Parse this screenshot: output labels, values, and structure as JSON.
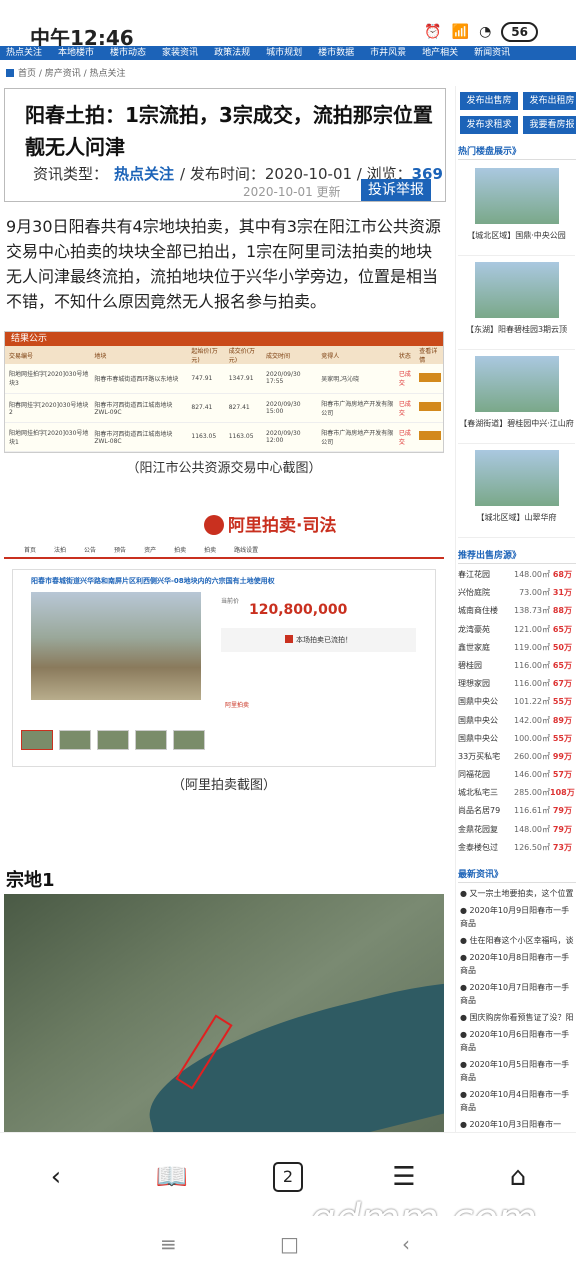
{
  "status": {
    "time": "中午12:46",
    "battery": "56",
    "hd": "HD"
  },
  "nav_strip": [
    "热点关注",
    "本地楼市",
    "楼市动态",
    "家装资讯",
    "政策法规",
    "城市规划",
    "楼市数据",
    "市井风景",
    "地产相关",
    "新闻资讯"
  ],
  "breadcrumb": "首页 / 房产资讯 / 热点关注",
  "article": {
    "title": "阳春土拍：1宗流拍，3宗成交，流拍那宗位置靓无人问津",
    "meta_prefix": "资讯类型：",
    "category": "热点关注",
    "date_label": "/ 发布时间：2020-10-01 / 浏览：",
    "views": "369",
    "updated": "2020-10-01 更新",
    "report_btn": "投诉举报",
    "paragraph": "9月30日阳春共有4宗地块拍卖，其中有3宗在阳江市公共资源交易中心拍卖的块块全部已拍出，1宗在阿里司法拍卖的地块无人问津最终流拍，流拍地块位于兴华小学旁边，位置是相当不错，不知什么原因竟然无人报名参与拍卖。",
    "caption1": "（阳江市公共资源交易中心截图）",
    "caption2": "（阿里拍卖截图）",
    "section1": "宗地1"
  },
  "img1": {
    "header": "结果公示",
    "columns": [
      "交易编号",
      "地块",
      "起始价(万元)",
      "成交价(万元)",
      "成交时间",
      "竞得人",
      "状态",
      "查看详情"
    ],
    "rows": [
      [
        "阳地网挂拍字[2020]030号地块3",
        "阳春市春城街道西环路以东地块",
        "747.91",
        "1347.91",
        "2020/09/30 17:55",
        "吴家明,冯沁晓",
        "已成交"
      ],
      [
        "阳春网挂字[2020]030号地块2",
        "阳春市河西街道西江城南地块ZWL-09C",
        "827.41",
        "827.41",
        "2020/09/30 15:00",
        "阳春市广海房地产开发有限公司",
        "已成交"
      ],
      [
        "阳地网挂拍字[2020]030号地块1",
        "阳春市河西街道西江城南地块ZWL-08C",
        "1163.05",
        "1163.05",
        "2020/09/30 12:00",
        "阳春市广海房地产开发有限公司",
        "已成交"
      ]
    ]
  },
  "img2": {
    "logo": "阿里拍卖·司法",
    "nav": [
      "首页",
      "法拍",
      "公告",
      "预告",
      "资产",
      "拍卖",
      "拍卖",
      "路线设置"
    ],
    "lot_title": "阳春市春城街道兴华路和南屏片区利西侧兴华-08地块内的六宗国有土地使用权",
    "price_label": "当前价",
    "price": "120,800,000",
    "status": "本场拍卖已流拍！",
    "brand": "阿里拍卖"
  },
  "sidebar": {
    "buttons": [
      "发布出售房",
      "发布出租房",
      "发布求租求",
      "我要看房报"
    ],
    "hot_title": "热门楼盘展示》",
    "hot": [
      "【城北区域】国鼎·中央公园",
      "【东湖】阳春碧桂园3期云顶",
      "【春湖街道】碧桂园中兴·江山府",
      "【城北区域】山翠华府"
    ],
    "sale_title": "推荐出售房源》",
    "sale": [
      [
        "春江花园",
        "148.00㎡",
        "68万"
      ],
      [
        "兴怡庭院",
        "73.00㎡",
        "31万"
      ],
      [
        "城南商住楼",
        "138.73㎡",
        "88万"
      ],
      [
        "龙湾豪苑",
        "121.00㎡",
        "65万"
      ],
      [
        "鑫世家庭",
        "119.00㎡",
        "50万"
      ],
      [
        "碧桂园",
        "116.00㎡",
        "65万"
      ],
      [
        "理想家园",
        "116.00㎡",
        "67万"
      ],
      [
        "国鼎中央公",
        "101.22㎡",
        "55万"
      ],
      [
        "国鼎中央公",
        "142.00㎡",
        "89万"
      ],
      [
        "国鼎中央公",
        "100.00㎡",
        "55万"
      ],
      [
        "33万买私宅",
        "260.00㎡",
        "99万"
      ],
      [
        "同福花园",
        "146.00㎡",
        "57万"
      ],
      [
        "城北私宅三",
        "285.00㎡",
        "108万"
      ],
      [
        "尚品名居79",
        "116.61㎡",
        "79万"
      ],
      [
        "金鼎花园复",
        "148.00㎡",
        "79万"
      ],
      [
        "金泰楼包过",
        "126.50㎡",
        "73万"
      ]
    ],
    "news_title": "最新资讯》",
    "news": [
      "又一宗土地要拍卖，这个位置",
      "2020年10月9日阳春市一手商品",
      "住在阳春这个小区幸福吗，谈",
      "2020年10月8日阳春市一手商品",
      "2020年10月7日阳春市一手商品",
      "国庆购房你看预售证了没？阳",
      "2020年10月6日阳春市一手商品",
      "2020年10月5日阳春市一手商品",
      "2020年10月4日阳春市一手商品",
      "2020年10月3日阳春市一"
    ]
  },
  "bottom_nav": {
    "tab_count": "2"
  },
  "watermark": "gdmm.com"
}
